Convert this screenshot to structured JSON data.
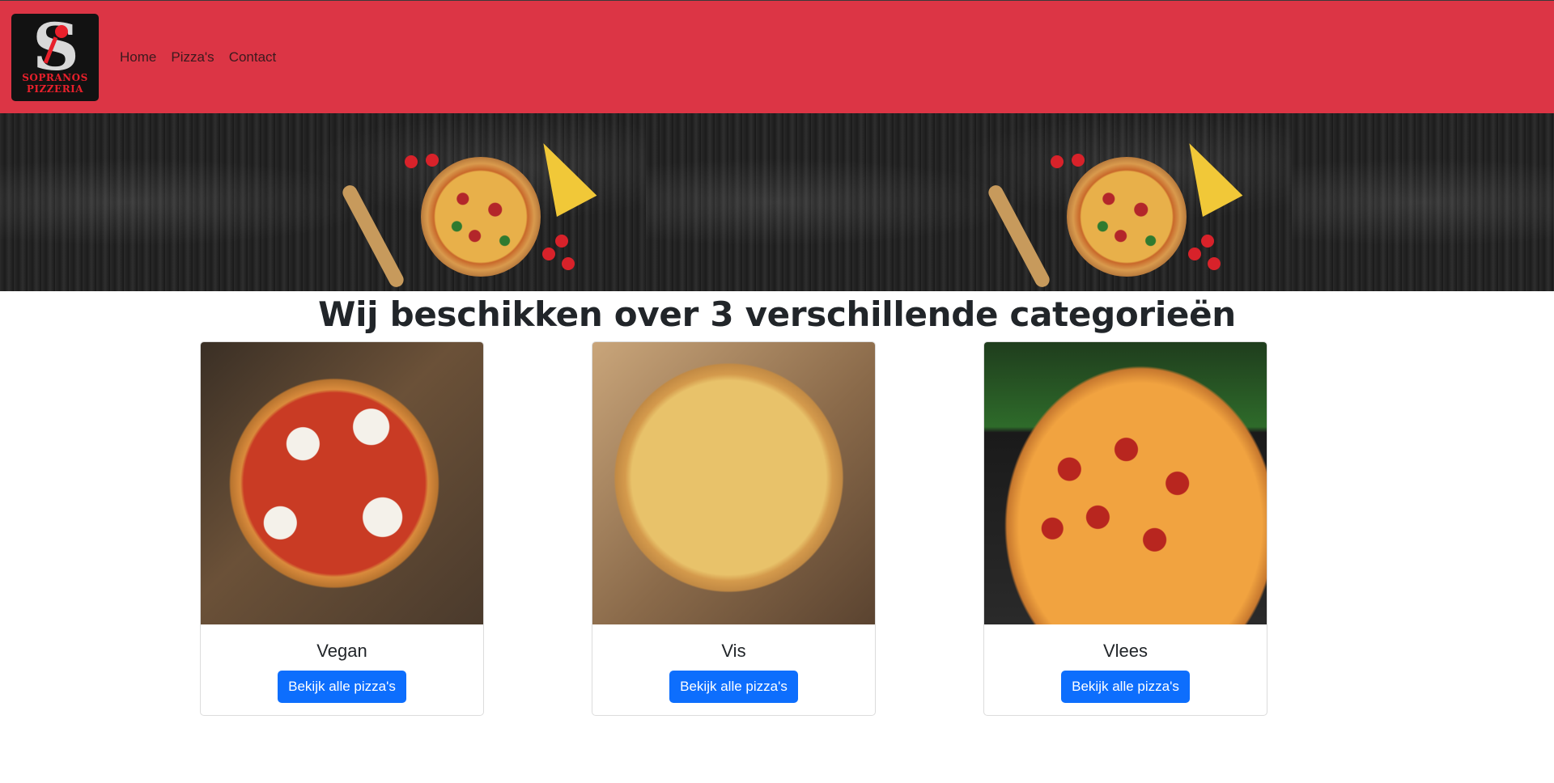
{
  "navbar": {
    "logo": {
      "icon": "sopranos-pizzeria-logo",
      "line1": "SOPRANOS",
      "line2": "PIZZERIA"
    },
    "links": [
      {
        "label": "Home"
      },
      {
        "label": "Pizza's"
      },
      {
        "label": "Contact"
      }
    ]
  },
  "hero": {
    "image": "pizza-banner-image"
  },
  "main": {
    "heading": "Wij beschikken over 3 verschillende categorieën",
    "categories": [
      {
        "title": "Vegan",
        "button": "Bekijk alle pizza's",
        "image": "vegan-pizza-image"
      },
      {
        "title": "Vis",
        "button": "Bekijk alle pizza's",
        "image": "fish-pizza-image"
      },
      {
        "title": "Vlees",
        "button": "Bekijk alle pizza's",
        "image": "pepperoni-pizza-image"
      }
    ]
  },
  "colors": {
    "navbar": "#dc3545",
    "button": "#0d6efd"
  }
}
